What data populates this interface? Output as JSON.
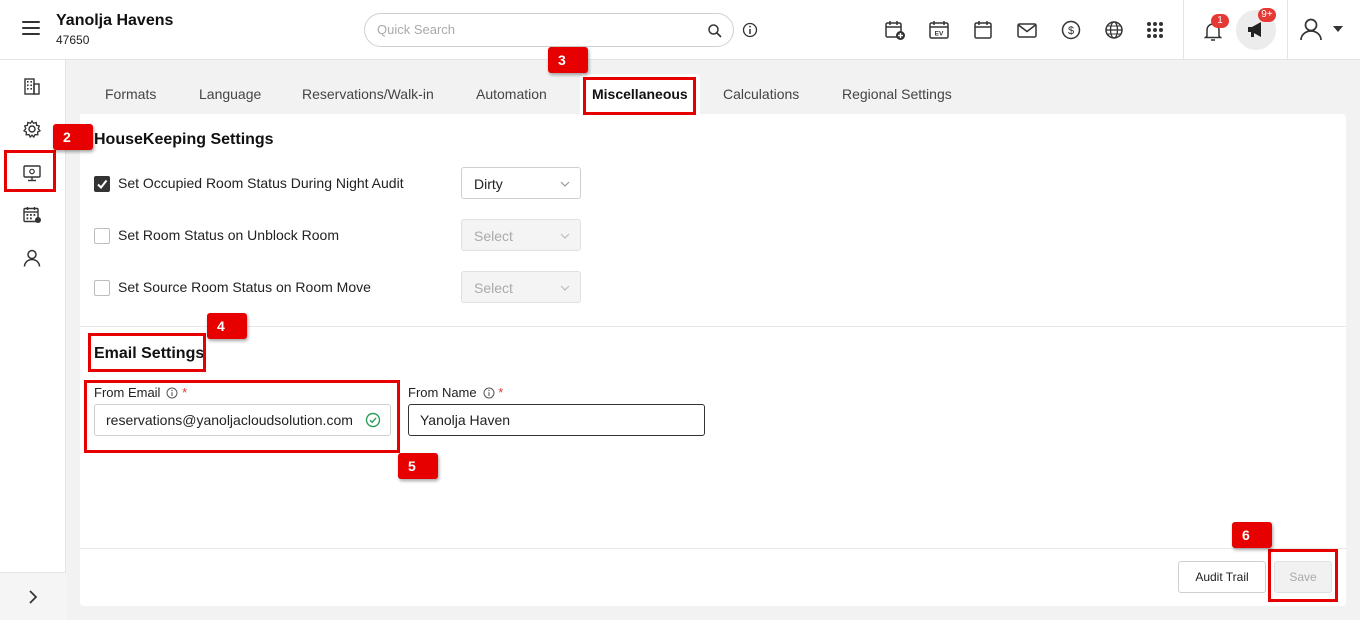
{
  "header": {
    "property_name": "Yanolja Havens",
    "property_code": "47650",
    "search_placeholder": "Quick Search",
    "notification_count": "1",
    "announcement_count": "9+"
  },
  "tabs": [
    {
      "label": "Formats"
    },
    {
      "label": "Language"
    },
    {
      "label": "Reservations/Walk-in"
    },
    {
      "label": "Automation"
    },
    {
      "label": "Miscellaneous"
    },
    {
      "label": "Calculations"
    },
    {
      "label": "Regional Settings"
    }
  ],
  "housekeeping": {
    "title": "HouseKeeping Settings",
    "rows": [
      {
        "label": "Set Occupied Room Status During Night Audit",
        "checked": true,
        "value": "Dirty"
      },
      {
        "label": "Set Room Status on Unblock Room",
        "checked": false,
        "value": "Select"
      },
      {
        "label": "Set Source Room Status on Room Move",
        "checked": false,
        "value": "Select"
      }
    ]
  },
  "email": {
    "title": "Email Settings",
    "from_email_label": "From Email",
    "from_email_value": "reservations@yanoljacloudsolution.com",
    "from_name_label": "From Name",
    "from_name_value": "Yanolja Haven",
    "required_mark": "*"
  },
  "actions": {
    "audit_trail": "Audit Trail",
    "save": "Save"
  },
  "annotations": {
    "step2": "2",
    "step3": "3",
    "step4": "4",
    "step5": "5",
    "step6": "6"
  },
  "colors": {
    "highlight": "#e60000",
    "badge": "#e53935",
    "valid": "#2e9e5b"
  }
}
